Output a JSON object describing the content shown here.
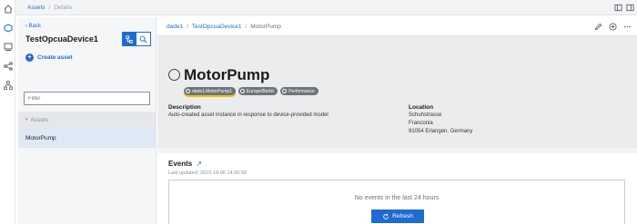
{
  "topbar": {
    "breadcrumb": [
      "Assets",
      "Details"
    ]
  },
  "left_panel": {
    "back_label": "Back",
    "device_title": "TestOpcuaDevice1",
    "create_label": "Create asset",
    "filter_placeholder": "Filter",
    "assets_header": "Assets",
    "asset_items": [
      "MotorPump"
    ]
  },
  "main": {
    "breadcrumb": [
      "dade1",
      "TestOpcuaDevice1",
      "MotorPump"
    ],
    "asset_name": "MotorPump",
    "tags": [
      "dade1.MotorPump1",
      "Europe/Berlin",
      "Performance"
    ],
    "description_heading": "Description",
    "description_text": "Auto-created asset instance in response to device-provided model",
    "location_heading": "Location",
    "location_lines": [
      "Schuhstrasse",
      "Franconia",
      "91054 Erlangen, Germany"
    ],
    "events_heading": "Events",
    "last_updated": "Last updated: 2023-10-06 14:30:58",
    "no_events": "No events in the last 24 hours",
    "refresh_label": "Refresh"
  },
  "colors": {
    "accent": "#1f6bd1",
    "highlight": "#f2c200"
  },
  "icons": [
    "home-icon",
    "assets-icon",
    "analytics-icon",
    "share-icon",
    "hierarchy-icon",
    "edit-icon",
    "add-icon",
    "more-icon",
    "tree-view-icon",
    "search-icon",
    "link-icon"
  ]
}
